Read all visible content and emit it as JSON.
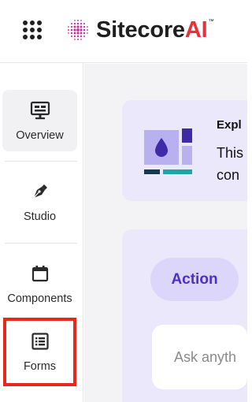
{
  "header": {
    "logo": {
      "primary": "Sitecore",
      "accent": "AI",
      "trademark": "™"
    },
    "app_launcher_icon": "grid-dots-icon"
  },
  "sidebar": {
    "items": [
      {
        "label": "Overview",
        "icon": "monitor-icon",
        "active": true
      },
      {
        "label": "Studio",
        "icon": "pen-nib-icon",
        "active": false
      },
      {
        "label": "Components",
        "icon": "calendar-icon",
        "active": false
      },
      {
        "label": "Forms",
        "icon": "form-list-icon",
        "active": false,
        "highlighted": true
      }
    ]
  },
  "main": {
    "explore_card": {
      "title": "Expl",
      "body_line_1": "This",
      "body_line_2": "con"
    },
    "assistant_card": {
      "action_chip": "Action",
      "input_placeholder": "Ask anyth"
    }
  },
  "colors": {
    "accent_purple": "#4b2fc7",
    "card_background": "#ebe8fb",
    "highlight_red": "#e8281c",
    "logo_accent": "#e7323d"
  }
}
